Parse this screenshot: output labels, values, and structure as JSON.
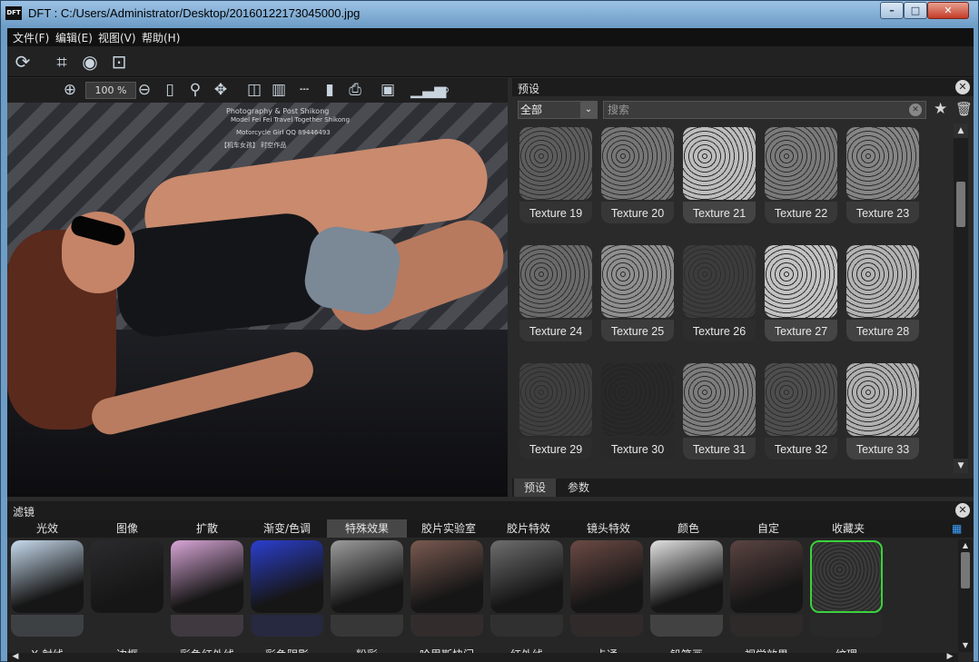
{
  "window": {
    "app_logo": "DFT",
    "title": "DFT : C:/Users/Administrator/Desktop/20160122173045000.jpg",
    "min": "–",
    "max": "□",
    "close": "✕"
  },
  "menu": [
    "文件(F)",
    "编辑(E)",
    "视图(V)",
    "帮助(H)"
  ],
  "image_toolbar": {
    "zoom": "100 %"
  },
  "photo": {
    "watermark_line1": "Photography & Post Shikong",
    "watermark_line2": "Model Fei Fei  Travel Together Shikong",
    "watermark_line3": "Motorcycle Girl     QQ 89446493",
    "watermark_line4": "【机车女孩】 时空作品"
  },
  "presets": {
    "title": "预设",
    "category_value": "全部",
    "search_placeholder": "搜索",
    "tiles": [
      {
        "label": "Texture 19",
        "color": "#5d5d5d"
      },
      {
        "label": "Texture 20",
        "color": "#767676"
      },
      {
        "label": "Texture 21",
        "color": "#bdbdbd"
      },
      {
        "label": "Texture 22",
        "color": "#7a7a7a"
      },
      {
        "label": "Texture 23",
        "color": "#858585"
      },
      {
        "label": "Texture 24",
        "color": "#6a6a6a"
      },
      {
        "label": "Texture 25",
        "color": "#8f8f8f"
      },
      {
        "label": "Texture 26",
        "color": "#3c3c3c"
      },
      {
        "label": "Texture 27",
        "color": "#c2c2c2"
      },
      {
        "label": "Texture 28",
        "color": "#b3b3b3"
      },
      {
        "label": "Texture 29",
        "color": "#3f3f3f"
      },
      {
        "label": "Texture 30",
        "color": "#262626"
      },
      {
        "label": "Texture 31",
        "color": "#7d7d7d"
      },
      {
        "label": "Texture 32",
        "color": "#4e4e4e"
      },
      {
        "label": "Texture 33",
        "color": "#b0b0b0"
      }
    ],
    "tabs": [
      "预设",
      "参数"
    ]
  },
  "filters": {
    "title": "滤镜",
    "categories": [
      "光效",
      "图像",
      "扩散",
      "渐变/色调",
      "特殊效果",
      "胶片实验室",
      "胶片特效",
      "镜头特效",
      "颜色",
      "自定",
      "收藏夹"
    ],
    "active_category": "特殊效果",
    "items": [
      {
        "label": "X-射线",
        "color": "#c8dcef"
      },
      {
        "label": "边框",
        "color": "#2b2b2e"
      },
      {
        "label": "彩色红外线",
        "color": "#d9a6d8"
      },
      {
        "label": "彩色阴影",
        "color": "#2b3fd0"
      },
      {
        "label": "粉彩",
        "color": "#9d9d9d"
      },
      {
        "label": "哈里斯快门",
        "color": "#7a5a50"
      },
      {
        "label": "红外线",
        "color": "#6e6e6e"
      },
      {
        "label": "卡通",
        "color": "#6c4a44"
      },
      {
        "label": "铅笔画",
        "color": "#e2e2e2"
      },
      {
        "label": "视觉效果",
        "color": "#5b4442"
      },
      {
        "label": "纹理",
        "color": "#3d3d3d"
      }
    ],
    "selected": "纹理"
  }
}
